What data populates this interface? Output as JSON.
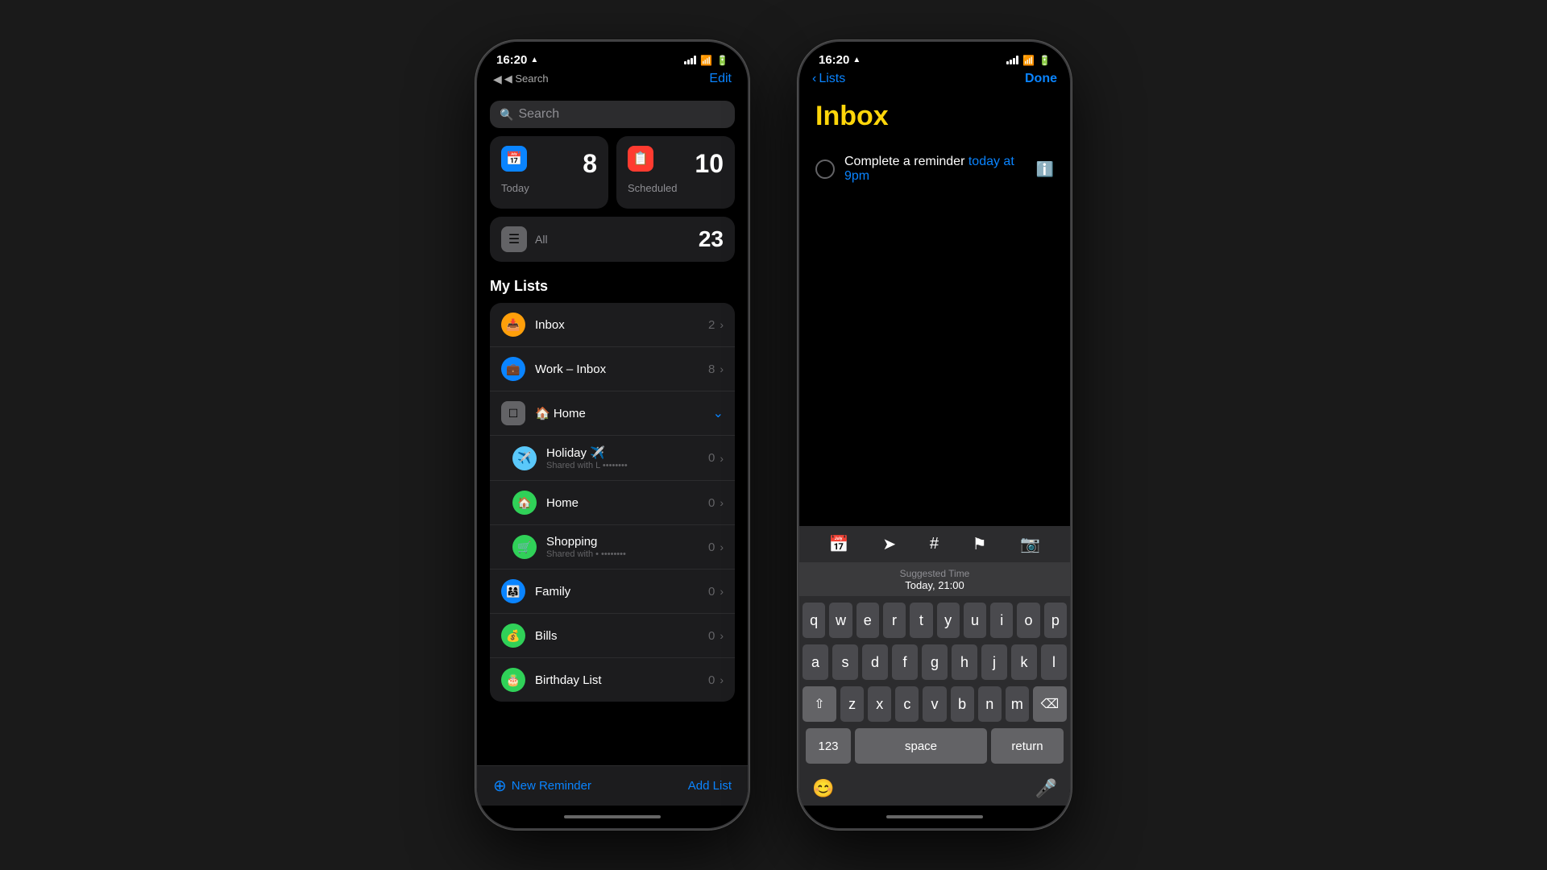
{
  "phone1": {
    "status": {
      "time": "16:20",
      "location": "▲",
      "back_label": "◀ Search"
    },
    "nav": {
      "back": "◀ Search",
      "edit": "Edit"
    },
    "search": {
      "placeholder": "Search"
    },
    "smart_lists": [
      {
        "id": "today",
        "label": "Today",
        "count": "8",
        "icon": "📅",
        "color": "blue"
      },
      {
        "id": "scheduled",
        "label": "Scheduled",
        "count": "10",
        "icon": "📋",
        "color": "red"
      }
    ],
    "all": {
      "label": "All",
      "count": "23",
      "icon": "☰"
    },
    "my_lists_title": "My Lists",
    "lists": [
      {
        "id": "inbox",
        "name": "Inbox",
        "icon": "📥",
        "color": "orange",
        "count": "2",
        "has_chevron": true
      },
      {
        "id": "work-inbox",
        "name": "Work – Inbox",
        "icon": "💼",
        "color": "blue",
        "count": "8",
        "has_chevron": true
      },
      {
        "id": "home-group",
        "name": "🏠 Home",
        "is_group": true
      },
      {
        "id": "holiday",
        "name": "Holiday ✈️",
        "icon": "✈️",
        "color": "teal",
        "count": "0",
        "sub": "Shared with L •••••••••",
        "has_chevron": true
      },
      {
        "id": "home",
        "name": "Home",
        "icon": "🏠",
        "color": "green",
        "count": "0",
        "has_chevron": true
      },
      {
        "id": "shopping",
        "name": "Shopping",
        "icon": "🛒",
        "color": "green",
        "count": "0",
        "sub": "Shared with • •••••••",
        "has_chevron": true
      },
      {
        "id": "family",
        "name": "Family",
        "icon": "👨‍👩‍👧",
        "color": "blue",
        "count": "0",
        "has_chevron": true
      },
      {
        "id": "bills",
        "name": "Bills",
        "icon": "💰",
        "color": "green",
        "count": "0",
        "has_chevron": true
      },
      {
        "id": "birthday",
        "name": "Birthday List",
        "icon": "🎂",
        "color": "green",
        "count": "0",
        "has_chevron": true
      }
    ],
    "bottom": {
      "new_reminder": "New Reminder",
      "add_list": "Add List"
    }
  },
  "phone2": {
    "status": {
      "time": "16:20"
    },
    "nav": {
      "back": "Lists",
      "done": "Done"
    },
    "page_title": "Inbox",
    "reminder": {
      "text": "Complete a reminder",
      "time_link": "today at 9pm"
    },
    "suggested_time": {
      "label": "Suggested Time",
      "value": "Today, 21:00"
    },
    "keyboard": {
      "rows": [
        [
          "q",
          "w",
          "e",
          "r",
          "t",
          "y",
          "u",
          "i",
          "o",
          "p"
        ],
        [
          "a",
          "s",
          "d",
          "f",
          "g",
          "h",
          "j",
          "k",
          "l"
        ],
        [
          "z",
          "x",
          "c",
          "v",
          "b",
          "n",
          "m"
        ]
      ],
      "nums": "123",
      "space": "space",
      "return": "return"
    }
  }
}
